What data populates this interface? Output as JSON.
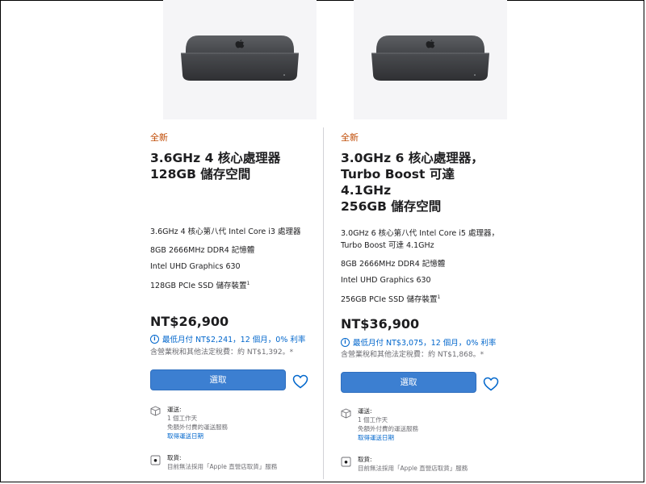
{
  "products": [
    {
      "tag": "全新",
      "title_lines": [
        "3.6GHz 4 核心處理器",
        "128GB 儲存空間"
      ],
      "specs": [
        "3.6GHz 4 核心第八代 Intel Core i3 處理器",
        "8GB 2666MHz DDR4 記憶體",
        "Intel UHD Graphics 630",
        "128GB PCIe SSD 儲存裝置"
      ],
      "spec_footnote": "1",
      "price": "NT$26,900",
      "monthly": "最低月付 NT$2,241，12 個月，0% 利率",
      "tax": "含營業稅和其他法定稅費：約 NT$1,392。*",
      "select_label": "選取",
      "shipping": {
        "label": "運送:",
        "lines": [
          "1 個工作天",
          "免額外付費的運送服務"
        ],
        "link": "取得運送日期"
      },
      "pickup": {
        "label": "取貨:",
        "line": "目前無法採用「Apple 直營店取貨」服務"
      }
    },
    {
      "tag": "全新",
      "title_lines": [
        "3.0GHz 6 核心處理器，",
        "Turbo Boost 可達",
        "4.1GHz",
        "256GB 儲存空間"
      ],
      "specs": [
        "3.0GHz 6 核心第八代 Intel Core i5 處理器，",
        "Turbo Boost 可達 4.1GHz",
        "8GB 2666MHz DDR4 記憶體",
        "Intel UHD Graphics 630",
        "256GB PCIe SSD 儲存裝置"
      ],
      "spec_footnote": "1",
      "price": "NT$36,900",
      "monthly": "最低月付 NT$3,075，12 個月，0% 利率",
      "tax": "含營業稅和其他法定稅費：約 NT$1,868。*",
      "select_label": "選取",
      "shipping": {
        "label": "運送:",
        "lines": [
          "1 個工作天",
          "免額外付費的運送服務"
        ],
        "link": "取得運送日期"
      },
      "pickup": {
        "label": "取貨:",
        "line": "目前無法採用「Apple 直營店取貨」服務"
      }
    }
  ],
  "colors": {
    "accent": "#0066cc",
    "button": "#3c7fd1",
    "new_tag": "#bf4800"
  },
  "icons": [
    "mac-mini-image",
    "info-icon",
    "heart-icon",
    "box-icon",
    "store-icon"
  ]
}
